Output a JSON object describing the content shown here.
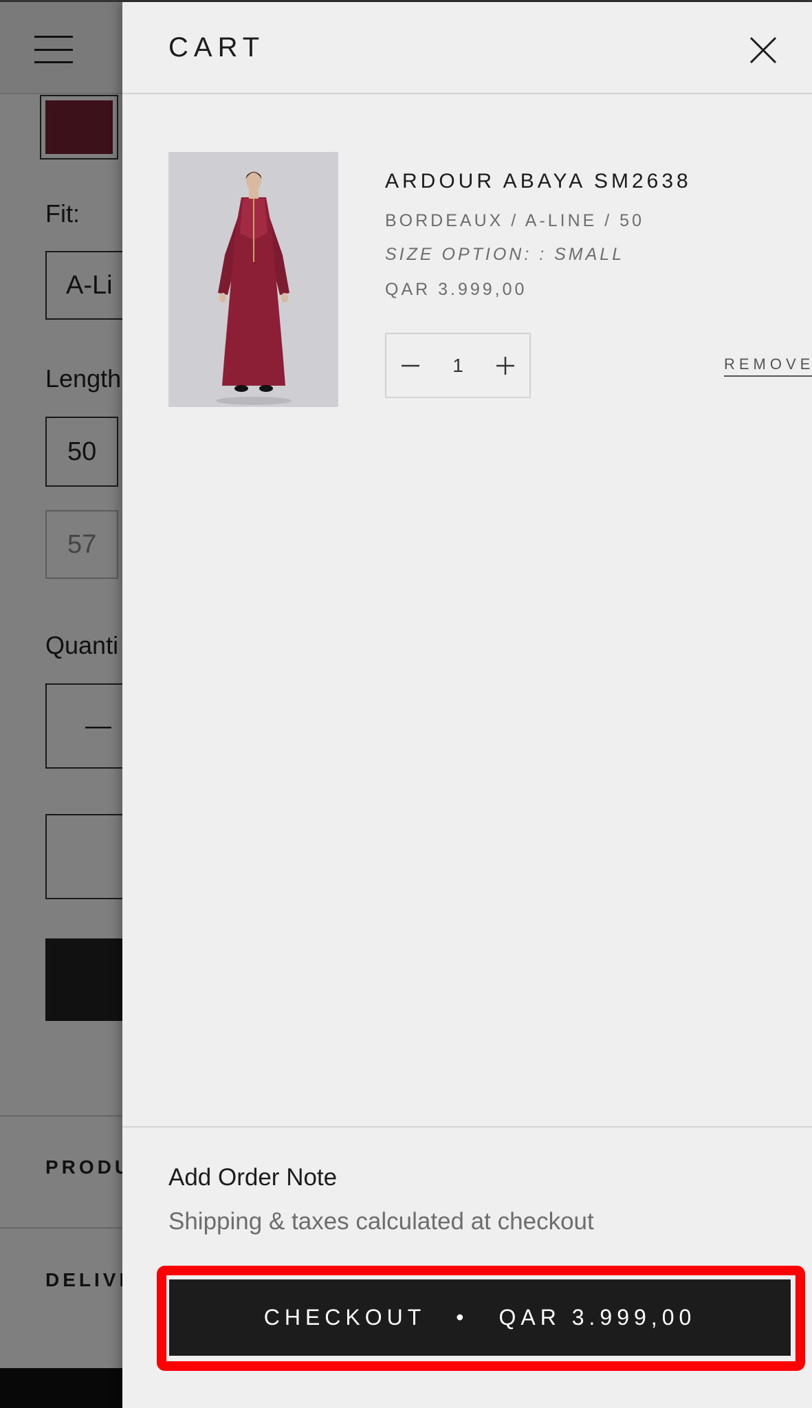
{
  "background_page": {
    "fit_label": "Fit:",
    "fit_value": "A-Li",
    "length_label": "Length",
    "length_selected": "50",
    "length_other": "57",
    "quantity_label": "Quanti",
    "quantity_minus": "—",
    "section_product": "PRODU",
    "section_delivery": "DELIVI",
    "swatch_color": "#7a2233"
  },
  "cart": {
    "title": "CART",
    "items": [
      {
        "title": "ARDOUR ABAYA SM2638",
        "variant": "BORDEAUX / A-LINE / 50",
        "option": "SIZE OPTION: : SMALL",
        "price": "QAR 3.999,00",
        "quantity": "1",
        "remove_label": "REMOVE",
        "dress_color": "#8c1f35"
      }
    ],
    "order_note_label": "Add Order Note",
    "shipping_note": "Shipping & taxes calculated at checkout",
    "checkout": {
      "label": "CHECKOUT",
      "separator": "•",
      "total": "QAR 3.999,00"
    }
  },
  "colors": {
    "drawer_bg": "#efefef",
    "button_bg": "#1c1c1c",
    "highlight": "#ff0000"
  },
  "icons": {
    "menu": "hamburger-menu-icon",
    "close": "close-icon",
    "minus": "minus-icon",
    "plus": "plus-icon"
  }
}
